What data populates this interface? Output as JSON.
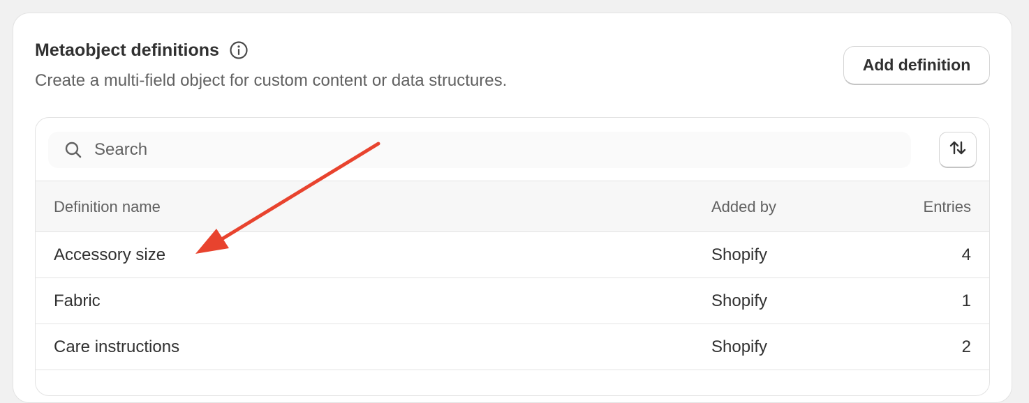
{
  "header": {
    "title": "Metaobject definitions",
    "subtitle": "Create a multi-field object for custom content or data structures.",
    "add_button_label": "Add definition"
  },
  "search": {
    "placeholder": "Search"
  },
  "icons": {
    "info": "info-icon",
    "search": "search-icon",
    "sort": "sort-arrows-icon"
  },
  "table": {
    "columns": {
      "name": "Definition name",
      "added_by": "Added by",
      "entries": "Entries"
    },
    "rows": [
      {
        "name": "Accessory size",
        "added_by": "Shopify",
        "entries": "4"
      },
      {
        "name": "Fabric",
        "added_by": "Shopify",
        "entries": "1"
      },
      {
        "name": "Care instructions",
        "added_by": "Shopify",
        "entries": "2"
      }
    ]
  },
  "colors": {
    "annotation_arrow": "#e8432e",
    "page_background": "#f1f1f1",
    "card_background": "#ffffff"
  }
}
